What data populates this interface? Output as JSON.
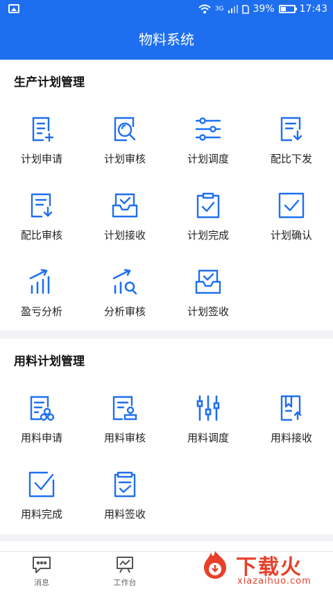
{
  "status": {
    "network": "3G",
    "battery": "39%",
    "battery_level": 0.39,
    "time": "17:43"
  },
  "header": {
    "title": "物料系统"
  },
  "accent": "#1e6ff0",
  "production": {
    "title": "生产计划管理",
    "items": [
      {
        "label": "计划申请",
        "icon": "document-plus-icon"
      },
      {
        "label": "计划审核",
        "icon": "search-review-icon"
      },
      {
        "label": "计划调度",
        "icon": "sliders-icon"
      },
      {
        "label": "配比下发",
        "icon": "document-download-icon"
      },
      {
        "label": "配比审核",
        "icon": "document-download-icon"
      },
      {
        "label": "计划接收",
        "icon": "inbox-check-icon"
      },
      {
        "label": "计划完成",
        "icon": "clipboard-check-icon"
      },
      {
        "label": "计划确认",
        "icon": "checkbox-icon"
      },
      {
        "label": "盈亏分析",
        "icon": "bar-chart-icon"
      },
      {
        "label": "分析审核",
        "icon": "chart-search-icon"
      },
      {
        "label": "计划签收",
        "icon": "inbox-check-icon"
      }
    ]
  },
  "material": {
    "title": "用料计划管理",
    "items": [
      {
        "label": "用料申请",
        "icon": "document-coins-icon"
      },
      {
        "label": "用料审核",
        "icon": "document-stamp-icon"
      },
      {
        "label": "用料调度",
        "icon": "vertical-sliders-icon"
      },
      {
        "label": "用料接收",
        "icon": "book-upload-icon"
      },
      {
        "label": "用料完成",
        "icon": "checkbox-icon"
      },
      {
        "label": "用料签收",
        "icon": "note-check-icon"
      }
    ]
  },
  "tabbar": {
    "tabs": [
      {
        "label": "消息",
        "icon": "message-icon"
      },
      {
        "label": "工作台",
        "icon": "workbench-icon"
      }
    ]
  },
  "watermark": {
    "text": "下载火",
    "sub": "xiazaihuo.com"
  }
}
